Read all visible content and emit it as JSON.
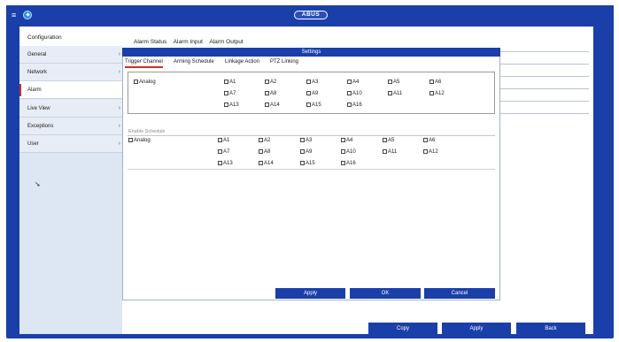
{
  "header": {
    "logo_text": "ABUS"
  },
  "sidebar": {
    "title": "Configuration",
    "items": [
      {
        "label": "General",
        "arrow": "›"
      },
      {
        "label": "Network",
        "arrow": "›"
      },
      {
        "label": "Alarm",
        "arrow": ""
      },
      {
        "label": "Live View",
        "arrow": "›"
      },
      {
        "label": "Exceptions",
        "arrow": "›"
      },
      {
        "label": "User",
        "arrow": "›"
      }
    ]
  },
  "subtabs": [
    "Alarm Status",
    "Alarm Input",
    "Alarm Output"
  ],
  "dialog": {
    "title": "Settings",
    "tabs": [
      "Trigger Channel",
      "Arming Schedule",
      "Linkage Action",
      "PTZ Linking"
    ],
    "trigger": {
      "analog_label": "Analog",
      "channels": [
        "A1",
        "A2",
        "A3",
        "A4",
        "A5",
        "A6",
        "A7",
        "A8",
        "A9",
        "A10",
        "A11",
        "A12",
        "A13",
        "A14",
        "A15",
        "A16"
      ]
    },
    "schedule": {
      "label": "Enable Schedule",
      "analog_label": "Analog",
      "channels": [
        "A1",
        "A2",
        "A3",
        "A4",
        "A5",
        "A6",
        "A7",
        "A8",
        "A9",
        "A10",
        "A11",
        "A12",
        "A13",
        "A14",
        "A15",
        "A16"
      ]
    },
    "buttons": {
      "apply": "Apply",
      "ok": "OK",
      "cancel": "Cancel"
    }
  },
  "footer_buttons": {
    "copy": "Copy",
    "apply": "Apply",
    "back": "Back"
  },
  "colors": {
    "primary_blue": "#1a3fa8",
    "accent_red": "#d22a2a",
    "sidebar_bg": "#dde6f3"
  }
}
